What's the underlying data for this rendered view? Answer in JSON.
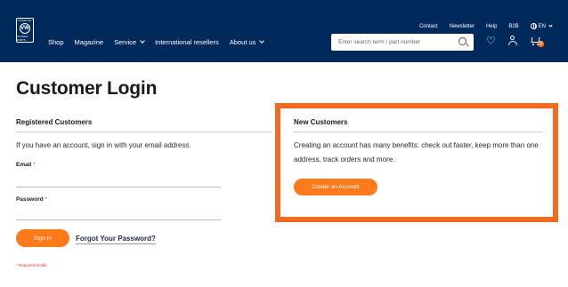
{
  "header": {
    "logo": {
      "top_text": "ORIGINAL",
      "emblem": "VW",
      "bottom_text": "CLASSIC PARTS"
    },
    "main_nav": [
      {
        "label": "Shop",
        "dropdown": false
      },
      {
        "label": "Magazine",
        "dropdown": false
      },
      {
        "label": "Service",
        "dropdown": true
      },
      {
        "label": "International resellers",
        "dropdown": false
      },
      {
        "label": "About us",
        "dropdown": true
      }
    ],
    "top_nav": [
      "Contact",
      "Newsletter",
      "Help",
      "B2B"
    ],
    "language": "EN",
    "search": {
      "placeholder": "Enter search term / part number"
    },
    "cart_count": "0"
  },
  "page_title": "Customer Login",
  "registered": {
    "title": "Registered Customers",
    "intro": "If you have an account, sign in with your email address.",
    "email_label": "Email",
    "password_label": "Password",
    "required_marker": "*",
    "signin_button": "Sign In",
    "forgot_link": "Forgot Your Password?",
    "required_note": "* Required Fields"
  },
  "new_customers": {
    "title": "New Customers",
    "text": "Creating an account has many benefits: check out faster, keep more than one address, track orders and more.",
    "create_button": "Create an Account"
  },
  "colors": {
    "header_bg": "#002a5c",
    "accent": "#ff7a1a",
    "highlight_border": "#f26b21"
  }
}
